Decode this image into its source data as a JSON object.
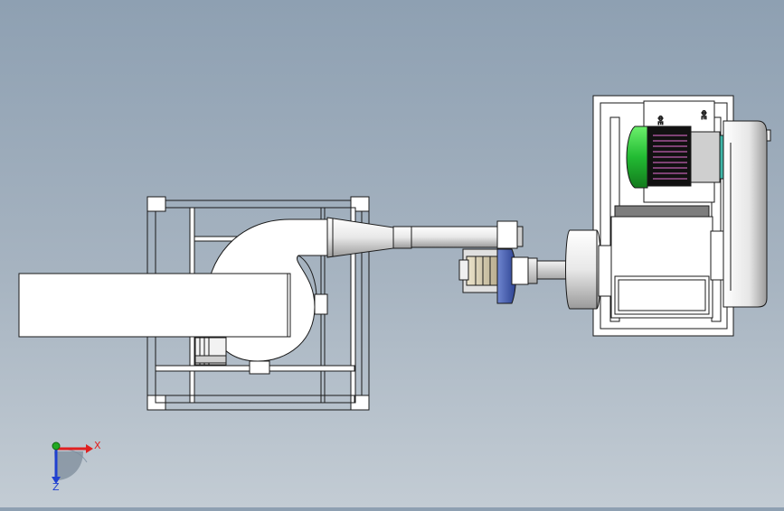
{
  "viewport": {
    "background_top": "#8ea0b2",
    "background_bottom": "#c3ccd4"
  },
  "model": {
    "line_color": "#1a1a1a",
    "body_fill": "#ffffff",
    "motor_fill": "#22bb33",
    "motor_cap_fill": "#1f8f2a",
    "coil_fill": "#8a2a78",
    "inlet_fill": "#3d5aa8",
    "gray_fill": "#7d7d7d",
    "fan_end_label_top": "ФЕ",
    "fan_end_label_top2": "ФЕ"
  },
  "triad": {
    "x_label": "X",
    "y_label": "Y",
    "z_label": "Z",
    "x_color": "#e02020",
    "y_color": "#22aa22",
    "z_color": "#2040d0"
  }
}
